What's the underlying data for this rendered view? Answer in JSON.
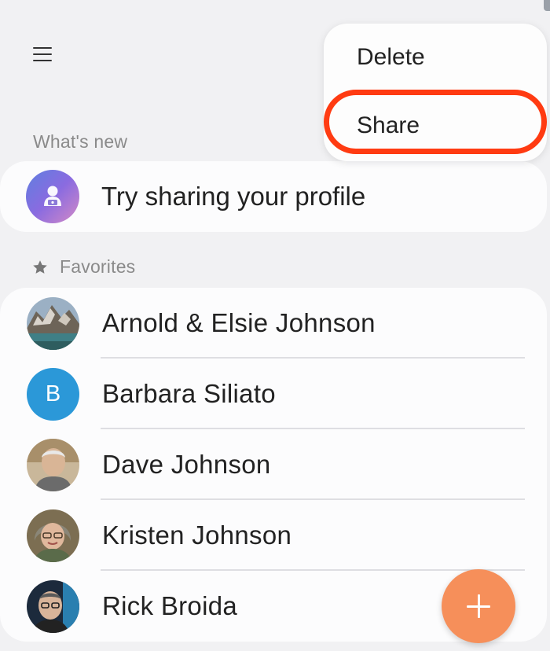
{
  "header": {
    "menu_icon": "hamburger-menu-icon"
  },
  "popup_menu": {
    "items": [
      {
        "label": "Delete"
      },
      {
        "label": "Share"
      }
    ],
    "highlighted_item": "Share",
    "highlight_color": "#ff3b12"
  },
  "whats_new": {
    "section_label": "What's new",
    "profile_prompt": "Try sharing your profile",
    "icon": "profile-share-icon"
  },
  "favorites": {
    "section_label": "Favorites",
    "section_icon": "star-icon",
    "contacts": [
      {
        "name": "Arnold & Elsie Johnson",
        "avatar": "photo-mountains"
      },
      {
        "name": "Barbara Siliato",
        "avatar_letter": "B",
        "avatar_color": "#2b98d8"
      },
      {
        "name": "Dave Johnson",
        "avatar": "photo-man"
      },
      {
        "name": "Kristen Johnson",
        "avatar": "photo-woman"
      },
      {
        "name": "Rick Broida",
        "avatar": "photo-man-glasses"
      }
    ]
  },
  "fab": {
    "icon": "plus-icon",
    "color": "#f68f5a"
  }
}
